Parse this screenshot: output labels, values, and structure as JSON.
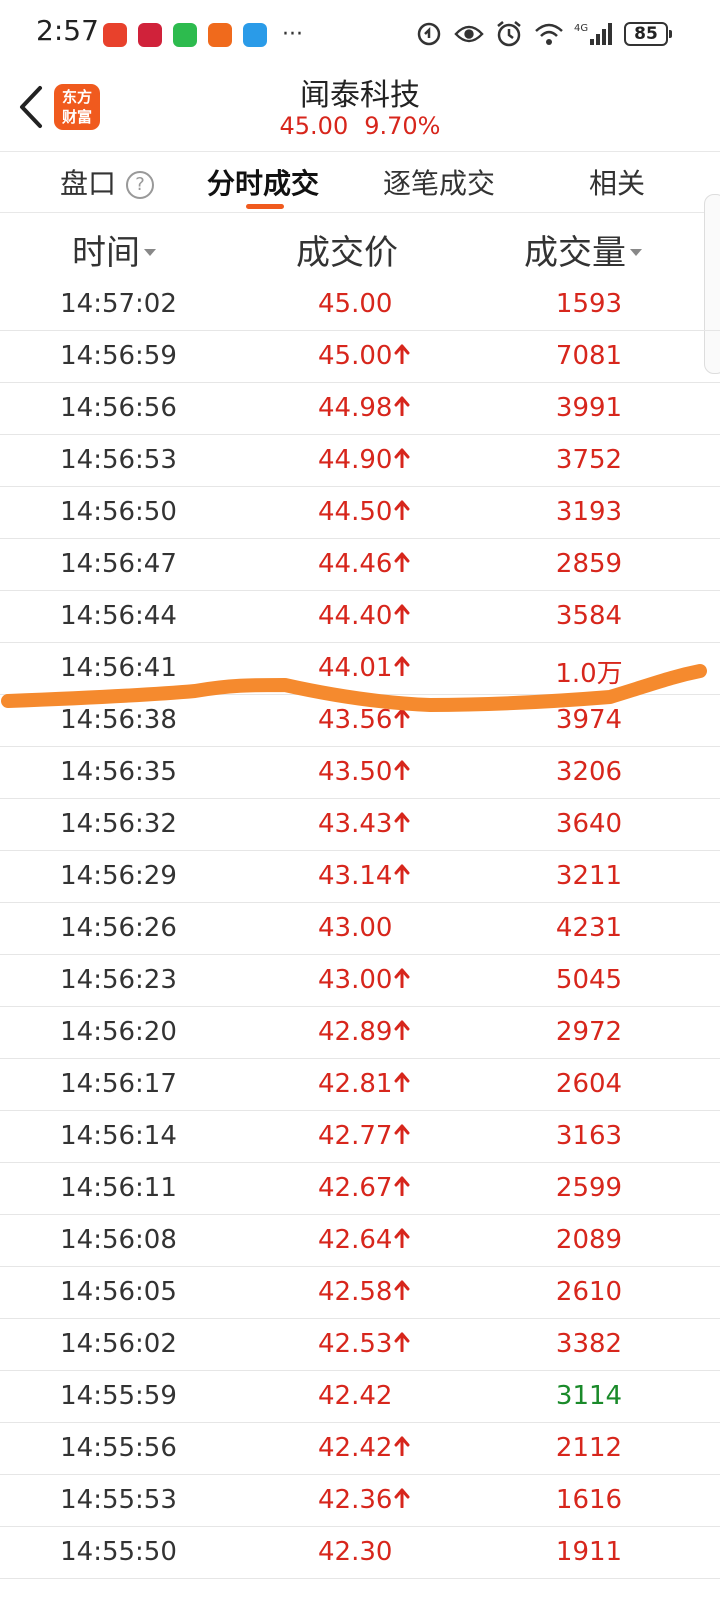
{
  "status_bar": {
    "time": "2:57",
    "notification_apps": [
      "huawei-app-icon",
      "news-app-icon",
      "wechat-icon",
      "send-app-icon",
      "cloud-app-icon"
    ],
    "more": "···",
    "network": "4G",
    "battery": "85"
  },
  "header": {
    "logo_line1": "东方",
    "logo_line2": "财富",
    "title": "闻泰科技",
    "price": "45.00",
    "change_pct": "9.70%"
  },
  "tabs": [
    {
      "label": "盘口",
      "active": false
    },
    {
      "label": "分时成交",
      "active": true
    },
    {
      "label": "逐笔成交",
      "active": false
    },
    {
      "label": "相关",
      "active": false
    }
  ],
  "help_mark": "?",
  "table": {
    "columns": [
      "时间",
      "成交价",
      "成交量"
    ],
    "rows": [
      {
        "time": "14:57:02",
        "price": "45.00",
        "up": false,
        "volume": "1593",
        "vol_color": "red"
      },
      {
        "time": "14:56:59",
        "price": "45.00",
        "up": true,
        "volume": "7081",
        "vol_color": "red"
      },
      {
        "time": "14:56:56",
        "price": "44.98",
        "up": true,
        "volume": "3991",
        "vol_color": "red"
      },
      {
        "time": "14:56:53",
        "price": "44.90",
        "up": true,
        "volume": "3752",
        "vol_color": "red"
      },
      {
        "time": "14:56:50",
        "price": "44.50",
        "up": true,
        "volume": "3193",
        "vol_color": "red"
      },
      {
        "time": "14:56:47",
        "price": "44.46",
        "up": true,
        "volume": "2859",
        "vol_color": "red"
      },
      {
        "time": "14:56:44",
        "price": "44.40",
        "up": true,
        "volume": "3584",
        "vol_color": "red"
      },
      {
        "time": "14:56:41",
        "price": "44.01",
        "up": true,
        "volume": "1.0万",
        "vol_color": "red"
      },
      {
        "time": "14:56:38",
        "price": "43.56",
        "up": true,
        "volume": "3974",
        "vol_color": "red"
      },
      {
        "time": "14:56:35",
        "price": "43.50",
        "up": true,
        "volume": "3206",
        "vol_color": "red"
      },
      {
        "time": "14:56:32",
        "price": "43.43",
        "up": true,
        "volume": "3640",
        "vol_color": "red"
      },
      {
        "time": "14:56:29",
        "price": "43.14",
        "up": true,
        "volume": "3211",
        "vol_color": "red"
      },
      {
        "time": "14:56:26",
        "price": "43.00",
        "up": false,
        "volume": "4231",
        "vol_color": "red"
      },
      {
        "time": "14:56:23",
        "price": "43.00",
        "up": true,
        "volume": "5045",
        "vol_color": "red"
      },
      {
        "time": "14:56:20",
        "price": "42.89",
        "up": true,
        "volume": "2972",
        "vol_color": "red"
      },
      {
        "time": "14:56:17",
        "price": "42.81",
        "up": true,
        "volume": "2604",
        "vol_color": "red"
      },
      {
        "time": "14:56:14",
        "price": "42.77",
        "up": true,
        "volume": "3163",
        "vol_color": "red"
      },
      {
        "time": "14:56:11",
        "price": "42.67",
        "up": true,
        "volume": "2599",
        "vol_color": "red"
      },
      {
        "time": "14:56:08",
        "price": "42.64",
        "up": true,
        "volume": "2089",
        "vol_color": "red"
      },
      {
        "time": "14:56:05",
        "price": "42.58",
        "up": true,
        "volume": "2610",
        "vol_color": "red"
      },
      {
        "time": "14:56:02",
        "price": "42.53",
        "up": true,
        "volume": "3382",
        "vol_color": "red"
      },
      {
        "time": "14:55:59",
        "price": "42.42",
        "up": false,
        "volume": "3114",
        "vol_color": "green"
      },
      {
        "time": "14:55:56",
        "price": "42.42",
        "up": true,
        "volume": "2112",
        "vol_color": "red"
      },
      {
        "time": "14:55:53",
        "price": "42.36",
        "up": true,
        "volume": "1616",
        "vol_color": "red"
      },
      {
        "time": "14:55:50",
        "price": "42.30",
        "up": false,
        "volume": "1911",
        "vol_color": "red"
      }
    ]
  },
  "colors": {
    "up_red": "#d7261c",
    "down_green": "#1a8a2a",
    "accent_orange": "#f05a1e",
    "annotation_orange": "#f58a2e"
  }
}
